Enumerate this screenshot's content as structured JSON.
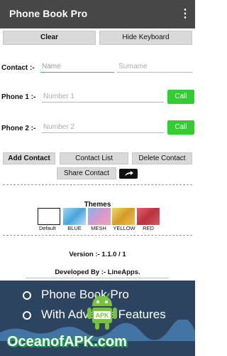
{
  "app": {
    "title": "Phone Book Pro",
    "menu_icon": "overflow-menu-icon"
  },
  "actions": {
    "clear": "Clear",
    "hide_keyboard": "Hide Keyboard"
  },
  "contact": {
    "label": "Contact :-",
    "name_placeholder": "Name",
    "surname_placeholder": "Surname"
  },
  "phone1": {
    "label": "Phone 1 :-",
    "placeholder": "Number 1",
    "call": "Call"
  },
  "phone2": {
    "label": "Phone 2 :-",
    "placeholder": "Number 2",
    "call": "Call"
  },
  "buttons": {
    "add_contact": "Add Contact",
    "contact_list": "Contact List",
    "delete_contact": "Delete Contact",
    "share_contact": "Share Contact",
    "share_icon": "share-icon"
  },
  "themes": {
    "title": "Themes",
    "items": [
      {
        "label": "Default",
        "color": "#ffffff"
      },
      {
        "label": "BLUE",
        "color": "#5fb8e8"
      },
      {
        "label": "MESH",
        "color": "#b98ac9"
      },
      {
        "label": "YELLOW",
        "color": "#e8b03a"
      },
      {
        "label": "RED",
        "color": "#c9444e"
      }
    ]
  },
  "footer": {
    "version": "Version :- 1.1.0 / 1",
    "developed": "Developed By :- LineApps."
  },
  "promo": {
    "line1": "Phone Book Pro",
    "line2": "With Advance Features",
    "watermark": "OceanofAPK.com",
    "badge": "APK"
  }
}
